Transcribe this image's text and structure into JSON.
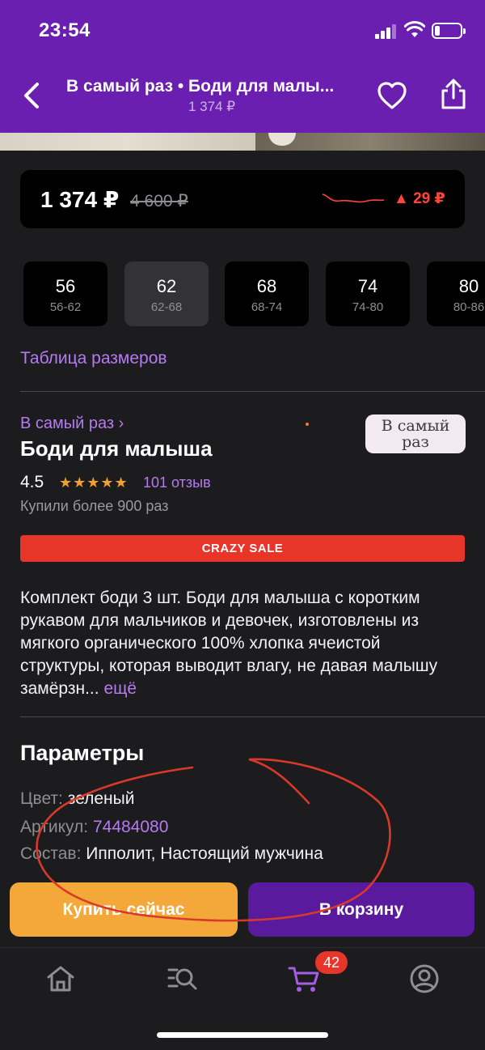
{
  "status_bar": {
    "time": "23:54"
  },
  "header": {
    "title": "В самый раз • Боди для малы...",
    "subtitle": "1 374 ₽"
  },
  "price": {
    "current": "1 374 ₽",
    "old": "4 600 ₽",
    "delta": "▲ 29 ₽",
    "delta_color": "#ff453a"
  },
  "sizes": [
    {
      "size": "56",
      "range": "56-62",
      "selected": false
    },
    {
      "size": "62",
      "range": "62-68",
      "selected": true
    },
    {
      "size": "68",
      "range": "68-74",
      "selected": false
    },
    {
      "size": "74",
      "range": "74-80",
      "selected": false
    },
    {
      "size": "80",
      "range": "80-86",
      "selected": false
    }
  ],
  "size_table_link": "Таблица размеров",
  "product": {
    "brand_link": "В самый раз ›",
    "brand_logo_text": "В самый раз",
    "title": "Боди для малыша",
    "rating": "4.5",
    "stars": "★★★★★",
    "reviews": "101 отзыв",
    "bought": "Купили более 900 раз",
    "sale_banner": "CRAZY SALE",
    "description": "Комплект боди 3 шт. Боди для малыша с коротким рукавом для мальчиков и девочек, изготовлены из мягкого органического 100% хлопка ячеистой структуры, которая выводит влагу, не давая малышу замёрзн...",
    "more": "ещё"
  },
  "params": {
    "title": "Параметры",
    "items": [
      {
        "key": "Цвет:",
        "value": "зеленый"
      },
      {
        "key": "Артикул:",
        "value": "74484080"
      },
      {
        "key": "Состав:",
        "value": "Ипполит, Настоящий мужчина"
      }
    ]
  },
  "actions": {
    "buy_now": "Купить сейчас",
    "add_to_cart": "В корзину",
    "buy_color": "#f5a83a",
    "cart_color": "#5a1a9e"
  },
  "tabbar": {
    "items": [
      "home-icon",
      "catalog-search-icon",
      "cart-icon",
      "profile-icon"
    ],
    "cart_badge": "42",
    "active_color": "#a35de6"
  },
  "colors": {
    "accent": "#6a1fb0",
    "link": "#b57bf0"
  }
}
